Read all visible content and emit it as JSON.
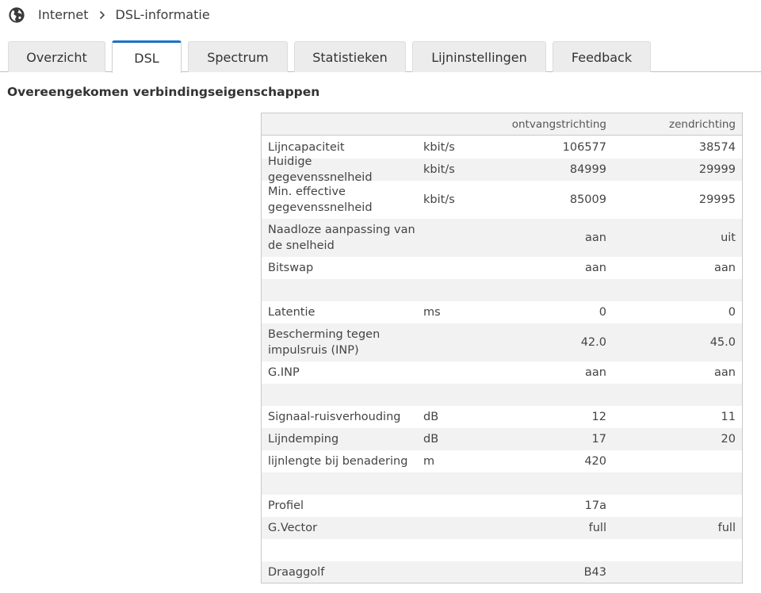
{
  "breadcrumb": {
    "icon": "globe-icon",
    "root": "Internet",
    "current": "DSL-informatie"
  },
  "tabs": [
    {
      "label": "Overzicht",
      "active": false
    },
    {
      "label": "DSL",
      "active": true
    },
    {
      "label": "Spectrum",
      "active": false
    },
    {
      "label": "Statistieken",
      "active": false
    },
    {
      "label": "Lijninstellingen",
      "active": false
    },
    {
      "label": "Feedback",
      "active": false
    }
  ],
  "section_title": "Overeengekomen verbindingseigenschappen",
  "table": {
    "headers": {
      "down": "ontvangstrichting",
      "up": "zendrichting"
    },
    "rows": [
      {
        "label": "Lijncapaciteit",
        "unit": "kbit/s",
        "down": "106577",
        "up": "38574"
      },
      {
        "label": "Huidige gegevenssnelheid",
        "unit": "kbit/s",
        "down": "84999",
        "up": "29999"
      },
      {
        "label": "Min. effective gegevenssnelheid",
        "unit": "kbit/s",
        "down": "85009",
        "up": "29995"
      },
      {
        "label": "Naadloze aanpassing van de snelheid",
        "unit": "",
        "down": "aan",
        "up": "uit"
      },
      {
        "label": "Bitswap",
        "unit": "",
        "down": "aan",
        "up": "aan"
      },
      {
        "label": "",
        "unit": "",
        "down": "",
        "up": ""
      },
      {
        "label": "Latentie",
        "unit": "ms",
        "down": "0",
        "up": "0"
      },
      {
        "label": "Bescherming tegen impulsruis (INP)",
        "unit": "",
        "down": "42.0",
        "up": "45.0"
      },
      {
        "label": "G.INP",
        "unit": "",
        "down": "aan",
        "up": "aan"
      },
      {
        "label": "",
        "unit": "",
        "down": "",
        "up": ""
      },
      {
        "label": "Signaal-ruisverhouding",
        "unit": "dB",
        "down": "12",
        "up": "11"
      },
      {
        "label": "Lijndemping",
        "unit": "dB",
        "down": "17",
        "up": "20"
      },
      {
        "label": "lijnlengte bij benadering",
        "unit": "m",
        "down": "420",
        "up": ""
      },
      {
        "label": "",
        "unit": "",
        "down": "",
        "up": ""
      },
      {
        "label": "Profiel",
        "unit": "",
        "down": "17a",
        "up": ""
      },
      {
        "label": "G.Vector",
        "unit": "",
        "down": "full",
        "up": "full"
      },
      {
        "label": "",
        "unit": "",
        "down": "",
        "up": ""
      },
      {
        "label": "Draaggolf",
        "unit": "",
        "down": "B43",
        "up": ""
      }
    ]
  }
}
